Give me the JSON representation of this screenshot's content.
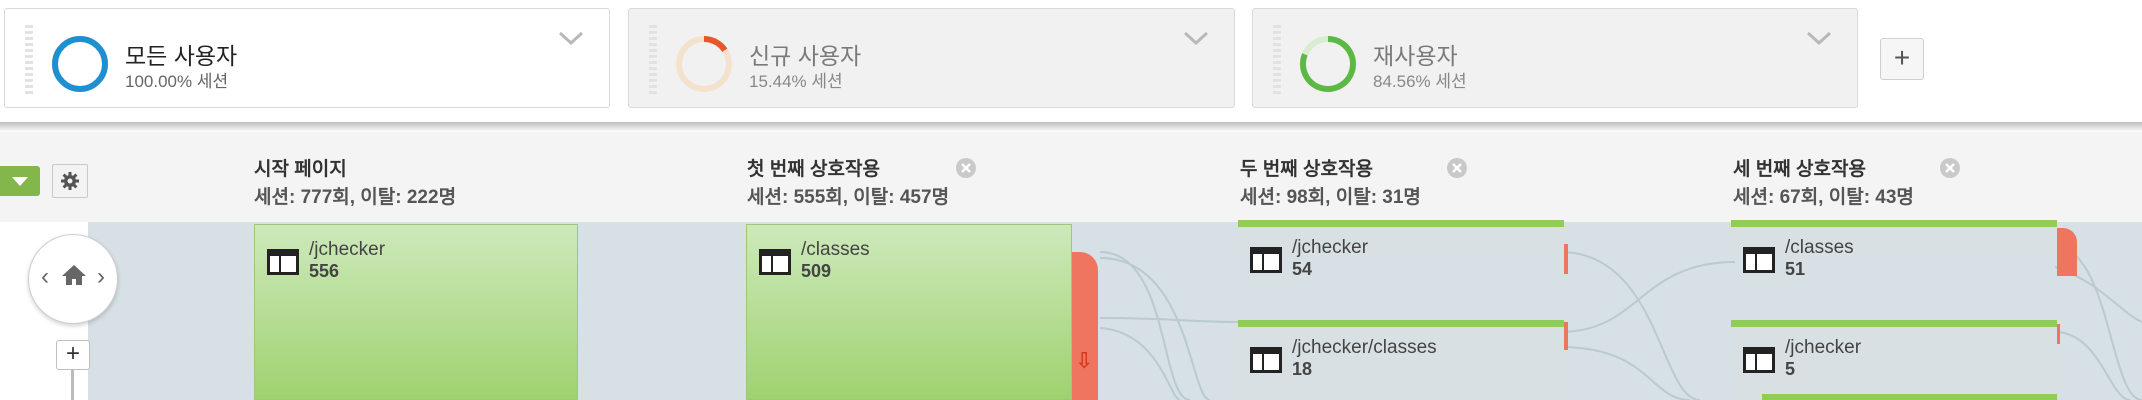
{
  "segments": [
    {
      "name": "모든 사용자",
      "sub": "100.00% 세션",
      "ring_color": "#1f8fd1",
      "fraction": 1.0,
      "state": "active"
    },
    {
      "name": "신규 사용자",
      "sub": "15.44% 세션",
      "ring_color": "#e8562a",
      "fraction": 0.1544,
      "state": "inactive"
    },
    {
      "name": "재사용자",
      "sub": "84.56% 세션",
      "ring_color": "#5db945",
      "fraction": 0.8456,
      "state": "inactive"
    }
  ],
  "add_segment_label": "+",
  "toolbar": {
    "dropdown_icon": "caret-down-icon",
    "settings_icon": "gear-icon"
  },
  "nav": {
    "prev": "‹",
    "next": "›",
    "home_icon": "home-icon",
    "zoom_in": "+"
  },
  "columns": [
    {
      "title": "시작 페이지",
      "stats": "세션: 777회, 이탈: 222명",
      "removable": false
    },
    {
      "title": "첫 번째 상호작용",
      "stats": "세션: 555회, 이탈: 457명",
      "removable": true
    },
    {
      "title": "두 번째 상호작용",
      "stats": "세션: 98회, 이탈: 31명",
      "removable": true
    },
    {
      "title": "세 번째 상호작용",
      "stats": "세션: 67회, 이탈: 43명",
      "removable": true
    }
  ],
  "nodes": [
    {
      "path": "/jchecker",
      "count": "556",
      "icon": "page-icon"
    },
    {
      "path": "/classes",
      "count": "509",
      "icon": "page-icon",
      "drop_icon": "down-arrow-icon"
    },
    {
      "path": "/jchecker",
      "count": "54",
      "icon": "page-icon"
    },
    {
      "path": "/jchecker/classes",
      "count": "18",
      "icon": "page-icon"
    },
    {
      "path": "/classes",
      "count": "51",
      "icon": "page-icon"
    },
    {
      "path": "/jchecker",
      "count": "5",
      "icon": "page-icon"
    }
  ]
}
